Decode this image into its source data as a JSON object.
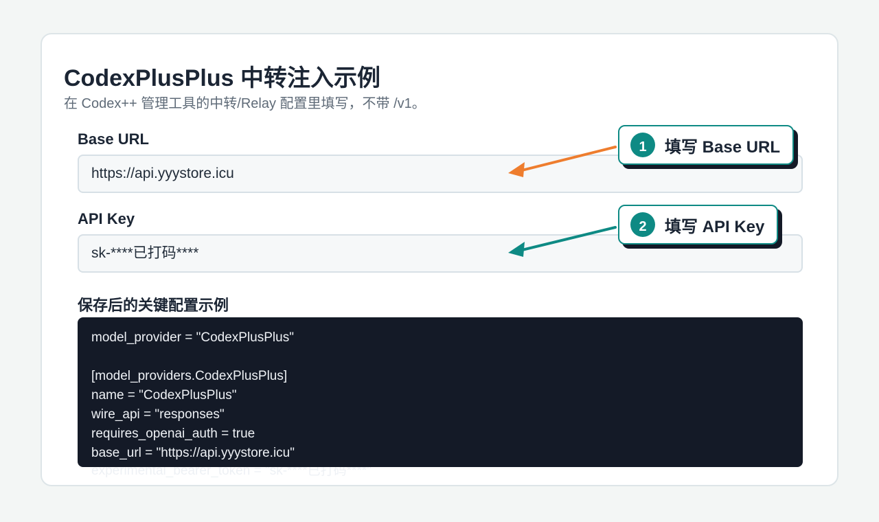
{
  "page": {
    "title": "CodexPlusPlus 中转注入示例",
    "subtitle": "在 Codex++ 管理工具的中转/Relay 配置里填写，不带 /v1。"
  },
  "fields": {
    "base_url": {
      "label": "Base URL",
      "value": "https://api.yyystore.icu"
    },
    "api_key": {
      "label": "API Key",
      "value": "sk-****已打码****"
    }
  },
  "config_example": {
    "label": "保存后的关键配置示例",
    "lines": [
      "model_provider = \"CodexPlusPlus\"",
      "",
      "[model_providers.CodexPlusPlus]",
      "name = \"CodexPlusPlus\"",
      "wire_api = \"responses\"",
      "requires_openai_auth = true",
      "base_url = \"https://api.yyystore.icu\"",
      "experimental_bearer_token = \"sk-****已打码****\""
    ]
  },
  "callouts": [
    {
      "number": "1",
      "text": "填写 Base URL",
      "arrow_color": "#ee7d2e"
    },
    {
      "number": "2",
      "text": "填写 API Key",
      "arrow_color": "#0e8a84"
    }
  ],
  "colors": {
    "accent_teal": "#0e8a84",
    "accent_orange": "#ee7d2e",
    "code_background": "#141a27"
  }
}
